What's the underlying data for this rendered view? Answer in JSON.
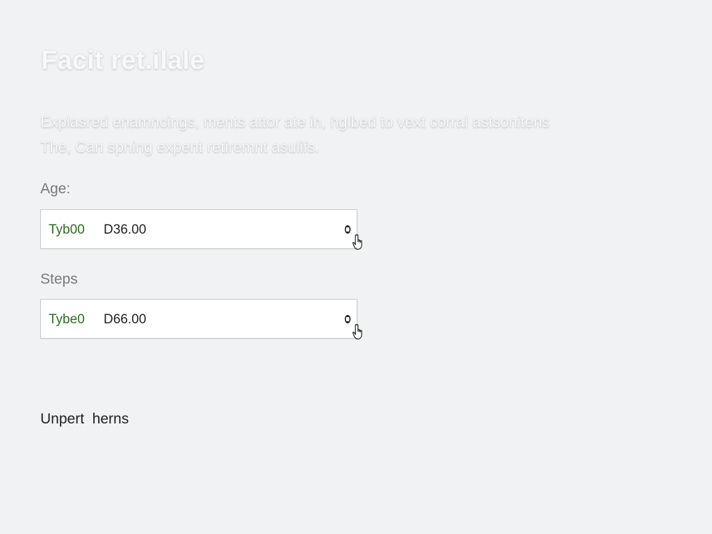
{
  "header": {
    "title": "Facit ret.ilale",
    "intro_line1": "Explasred enamncings, ments attor ate in, hglbed to vext corral astsonitens",
    "intro_line2": "The, Can spning expent retiremnt asulifs."
  },
  "form": {
    "age": {
      "label": "Age:",
      "prefix": "Tyb00",
      "value": "D36.00",
      "stepper_icon": "stepper-arrows-icon"
    },
    "steps": {
      "label": "Steps",
      "prefix": "Tybe0",
      "value": "D66.00",
      "stepper_icon": "stepper-arrows-icon"
    }
  },
  "footer": {
    "text": "Unpert  herns"
  },
  "cursor_icon": "hand-pointer-icon",
  "colors": {
    "background": "#f1f2f3",
    "prefix_green": "#2f6b1e",
    "label_gray": "#77797b"
  }
}
